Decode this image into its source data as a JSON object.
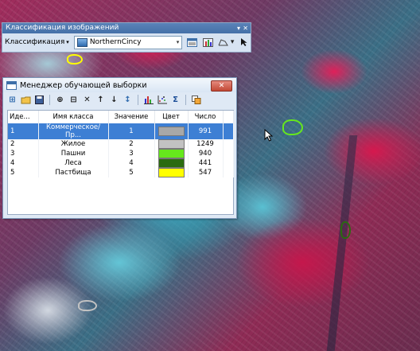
{
  "classify_toolbar": {
    "title": "Классификация изображений",
    "title_buttons": [
      "▾",
      "✕"
    ],
    "menu_label": "Классификация",
    "layer_value": "NorthernCincy"
  },
  "manager": {
    "title": "Менеджер обучающей выборки",
    "close_glyph": "✕",
    "toolbar": [
      "⊞",
      "📂",
      "💾",
      "⊕",
      "⊟",
      "✕",
      "↑",
      "↓",
      "↕",
      "▮",
      "⁙",
      "Σ",
      "⧉"
    ],
    "columns": [
      "Иде...",
      "Имя класса",
      "Значение",
      "Цвет",
      "Число"
    ],
    "rows": [
      {
        "id": "1",
        "name": "Коммерческое/Пр...",
        "value": "1",
        "color": "#a8a8a8",
        "count": "991"
      },
      {
        "id": "2",
        "name": "Жилое",
        "value": "2",
        "color": "#c2c2c2",
        "count": "1249"
      },
      {
        "id": "3",
        "name": "Пашни",
        "value": "3",
        "color": "#66e81c",
        "count": "940"
      },
      {
        "id": "4",
        "name": "Леса",
        "value": "4",
        "color": "#2a6b10",
        "count": "441"
      },
      {
        "id": "5",
        "name": "Пастбища",
        "value": "5",
        "color": "#ffff00",
        "count": "547"
      }
    ]
  }
}
